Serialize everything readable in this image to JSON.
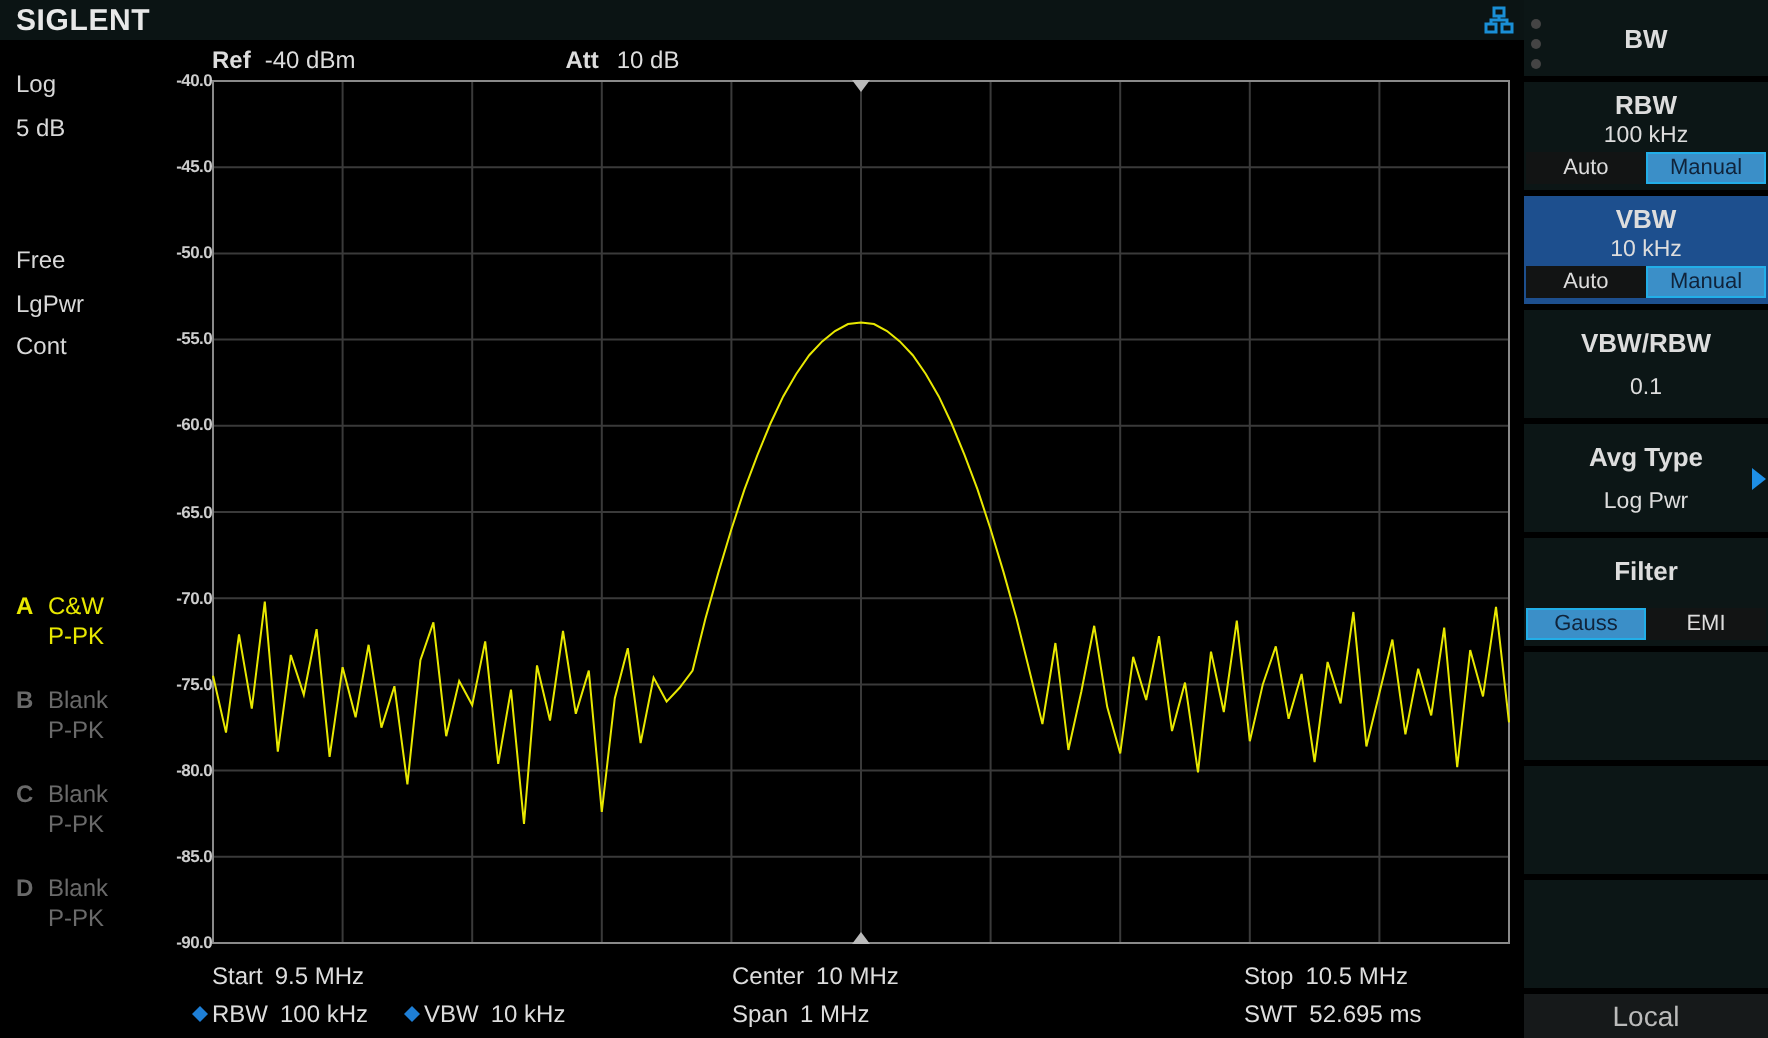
{
  "top_bar": {
    "logo": "SIGLENT"
  },
  "plot_header": {
    "ref_label": "Ref",
    "ref_value": "-40 dBm",
    "att_label": "Att",
    "att_value": "10 dB"
  },
  "status": {
    "scale_type": "Log",
    "scale_div": "5 dB",
    "trigger": "Free",
    "avg_type": "LgPwr",
    "sweep": "Cont"
  },
  "traces": [
    {
      "letter": "A",
      "type": "C&W",
      "detector": "P-PK",
      "active": true
    },
    {
      "letter": "B",
      "type": "Blank",
      "detector": "P-PK",
      "active": false
    },
    {
      "letter": "C",
      "type": "Blank",
      "detector": "P-PK",
      "active": false
    },
    {
      "letter": "D",
      "type": "Blank",
      "detector": "P-PK",
      "active": false
    }
  ],
  "plot": {
    "chart_data": {
      "type": "line",
      "grid": true,
      "ylim": [
        -90,
        -40
      ],
      "yticks": [
        {
          "value": -40,
          "label": "-40.0"
        },
        {
          "value": -45,
          "label": "-45.0"
        },
        {
          "value": -50,
          "label": "-50.0"
        },
        {
          "value": -55,
          "label": "-55.0"
        },
        {
          "value": -60,
          "label": "-60.0"
        },
        {
          "value": -65,
          "label": "-65.0"
        },
        {
          "value": -70,
          "label": "-70.0"
        },
        {
          "value": -75,
          "label": "-75.0"
        },
        {
          "value": -80,
          "label": "-80.0"
        },
        {
          "value": -85,
          "label": "-85.0"
        },
        {
          "value": -90,
          "label": "-90.0"
        }
      ],
      "categories": [
        null,
        null,
        null,
        null,
        null,
        null,
        null,
        null,
        null,
        null,
        null,
        null,
        null,
        null,
        null,
        null,
        null,
        null,
        null,
        null,
        null,
        null,
        null,
        null,
        null,
        null,
        null,
        null,
        null,
        null,
        null,
        null,
        null,
        null,
        null,
        null,
        null,
        null,
        null,
        null,
        null,
        null,
        null,
        null,
        null,
        null,
        null,
        null,
        null,
        null,
        null,
        null,
        null,
        null,
        null,
        null,
        null,
        null,
        null,
        null,
        null,
        null,
        null,
        null,
        null,
        null,
        null,
        null,
        null,
        null,
        null,
        null,
        null,
        null,
        null,
        null,
        null,
        null,
        null,
        null,
        null,
        null,
        null,
        null,
        null,
        null,
        null,
        null,
        null,
        null,
        null,
        null,
        null,
        null,
        null,
        null,
        null,
        null,
        null,
        null,
        null
      ],
      "series": [
        {
          "color": "#e8e800",
          "values": [
            -74.5,
            -77.8,
            -72.1,
            -76.4,
            -70.2,
            -78.9,
            -73.3,
            -75.6,
            -71.8,
            -79.2,
            -74.0,
            -76.9,
            -72.7,
            -77.5,
            -75.1,
            -80.8,
            -73.6,
            -71.4,
            -78.0,
            -74.8,
            -76.2,
            -72.5,
            -79.6,
            -75.3,
            -83.1,
            -73.9,
            -77.1,
            -71.9,
            -76.7,
            -74.2,
            -82.4,
            -75.8,
            -72.9,
            -78.4,
            -74.6,
            -76.0,
            -75.2,
            -74.2,
            -71.2,
            -68.5,
            -66.0,
            -63.7,
            -61.7,
            -59.9,
            -58.3,
            -57.0,
            -55.9,
            -55.1,
            -54.5,
            -54.1,
            -54.0,
            -54.1,
            -54.5,
            -55.1,
            -55.9,
            -57.0,
            -58.3,
            -59.9,
            -61.7,
            -63.7,
            -66.0,
            -68.5,
            -71.2,
            -74.2,
            -77.3,
            -72.6,
            -78.8,
            -75.4,
            -71.6,
            -76.3,
            -79.0,
            -73.4,
            -75.9,
            -72.2,
            -77.7,
            -74.9,
            -80.1,
            -73.1,
            -76.6,
            -71.3,
            -78.3,
            -75.0,
            -72.8,
            -77.0,
            -74.4,
            -79.5,
            -73.7,
            -76.1,
            -70.8,
            -78.6,
            -75.5,
            -72.4,
            -77.9,
            -74.1,
            -76.8,
            -71.7,
            -79.8,
            -73.0,
            -75.7,
            -70.5,
            -77.2
          ]
        }
      ]
    }
  },
  "footer": {
    "start": {
      "label": "Start",
      "value": "9.5 MHz"
    },
    "center": {
      "label": "Center",
      "value": "10 MHz"
    },
    "stop": {
      "label": "Stop",
      "value": "10.5 MHz"
    },
    "rbw": {
      "label": "RBW",
      "value": "100 kHz",
      "manual": true
    },
    "vbw": {
      "label": "VBW",
      "value": "10 kHz",
      "manual": true
    },
    "span": {
      "label": "Span",
      "value": "1 MHz"
    },
    "swt": {
      "label": "SWT",
      "value": "52.695 ms"
    }
  },
  "menu": {
    "title": "BW",
    "items": [
      {
        "kind": "toggle",
        "label": "RBW",
        "value": "100 kHz",
        "selected": false,
        "options": [
          {
            "label": "Auto",
            "selected": false
          },
          {
            "label": "Manual",
            "selected": true
          }
        ]
      },
      {
        "kind": "toggle",
        "label": "VBW",
        "value": "10 kHz",
        "selected": true,
        "options": [
          {
            "label": "Auto",
            "selected": false
          },
          {
            "label": "Manual",
            "selected": true
          }
        ]
      },
      {
        "kind": "value",
        "label": "VBW/RBW",
        "value": "0.1",
        "selected": false
      },
      {
        "kind": "submenu",
        "label": "Avg Type",
        "value": "Log Pwr",
        "selected": false
      },
      {
        "kind": "switch",
        "label": "Filter",
        "selected": false,
        "options": [
          {
            "label": "Gauss",
            "selected": true
          },
          {
            "label": "EMI",
            "selected": false
          }
        ]
      },
      {
        "kind": "empty"
      },
      {
        "kind": "empty"
      },
      {
        "kind": "empty"
      }
    ],
    "footer": "Local"
  }
}
